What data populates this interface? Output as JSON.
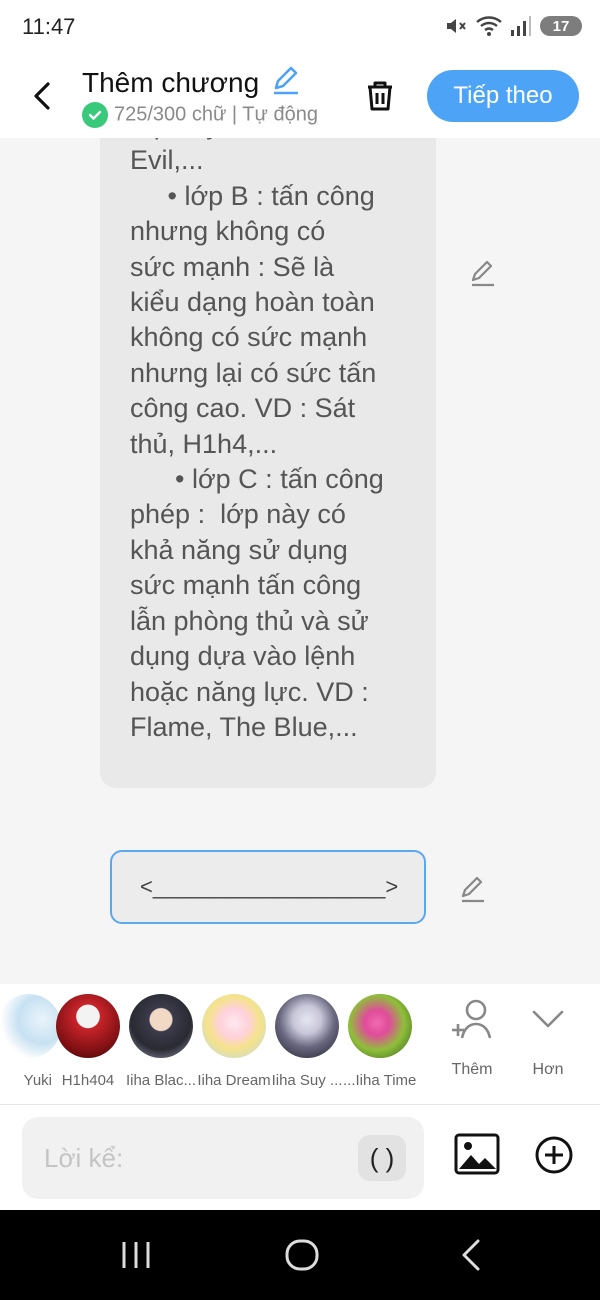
{
  "status_bar": {
    "time": "11:47",
    "battery": "17"
  },
  "header": {
    "title": "Thêm chương",
    "word_count": "725/300 chữ | Tự động",
    "next_button": "Tiếp theo"
  },
  "story": {
    "text_block": "lớp này. VD : Killer,\nEvil,...\n     • lớp B : tấn công\nnhưng không có\nsức mạnh : Sẽ là\nkiểu dạng hoàn toàn\nkhông có sức mạnh\nnhưng lại có sức tấn\ncông cao. VD : Sát\nthủ, H1h4,...\n      • lớp C : tấn công\nphép :  lớp này có\nkhả năng sử dụng\nsức mạnh tấn công\nlẫn phòng thủ và sử\ndụng dựa vào lệnh\nhoặc năng lực. VD :\nFlame, The Blue,...",
    "divider_text": "<___________________>"
  },
  "characters": [
    {
      "name": "Yuki"
    },
    {
      "name": "H1h404"
    },
    {
      "name": "Iiha Blac..."
    },
    {
      "name": "Iiha Dream"
    },
    {
      "name": "Iiha Suy ..."
    },
    {
      "name": "...Iiha Time."
    }
  ],
  "tools": {
    "add_label": "Thêm",
    "more_label": "Hơn"
  },
  "input": {
    "placeholder": "Lời kể:",
    "paren_label": "( )"
  },
  "colors": {
    "accent": "#4da3f5",
    "check": "#39c97a",
    "divider_border": "#5aa8ee"
  }
}
